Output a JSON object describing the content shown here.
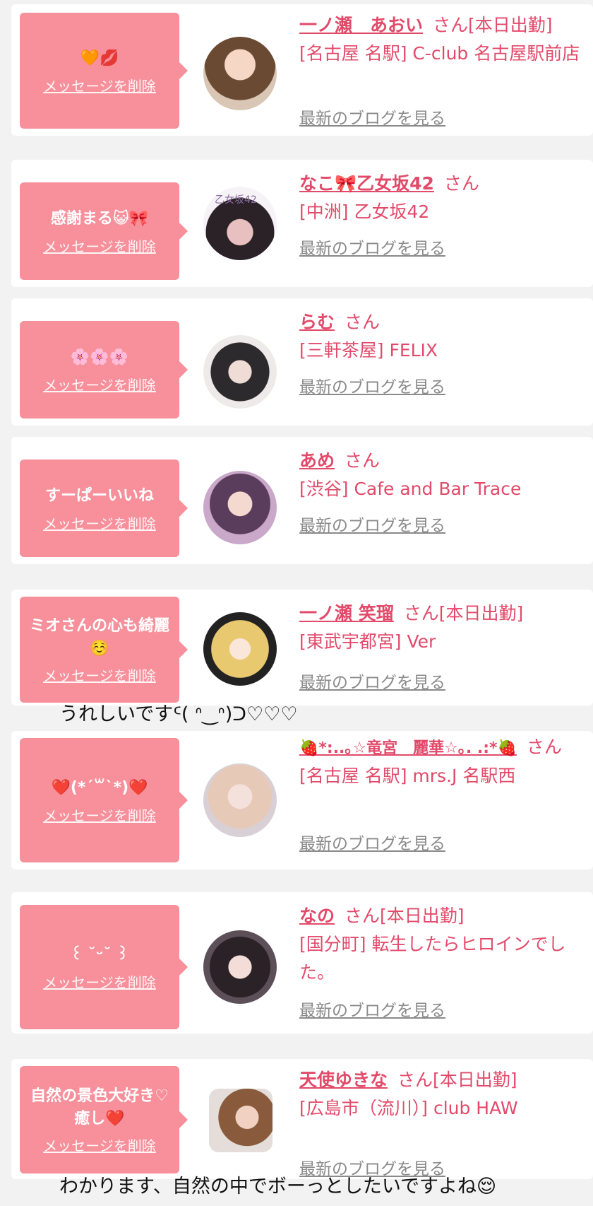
{
  "del_label": "メッセージを削除",
  "blog_label": "最新のブログを見る",
  "entries": [
    {
      "message": "🧡💋",
      "name": "一ノ瀬　あおい",
      "suffix": "さん[本日出勤]",
      "shop": "[名古屋 名駅] C-club 名古屋駅前店"
    },
    {
      "message": "感謝まる😺🎀",
      "name": "なこ🎀乙女坂42",
      "suffix": "さん",
      "shop": "[中洲] 乙女坂42"
    },
    {
      "message": "🌸🌸🌸",
      "name": "らむ",
      "suffix": "さん",
      "shop": "[三軒茶屋] FELIX"
    },
    {
      "message": "すーぱーいいね",
      "name": "あめ",
      "suffix": "さん",
      "shop": "[渋谷] Cafe and Bar Trace"
    },
    {
      "message": "ミオさんの心も綺麗☺️",
      "name": "一ノ瀬 笑瑠",
      "suffix": "さん[本日出勤]",
      "shop": "[東武宇都宮] Ver"
    },
    {
      "message": "❤️(*´꒳`*)❤️",
      "name": "🍓*:..｡☆竜宮　麗華☆｡. .:*🍓",
      "suffix": "さん",
      "shop": "[名古屋 名駅] mrs.J 名駅西"
    },
    {
      "message": "꒰ ˘ᵕ˘ ꒱",
      "name": "なの",
      "suffix": "さん[本日出勤]",
      "shop": "[国分町] 転生したらヒロインでした。"
    },
    {
      "message": "自然の景色大好き♡癒し❤️",
      "name": "天使ゆきな",
      "suffix": "さん[本日出勤]",
      "shop": "[広島市（流川）] club HAW"
    }
  ],
  "overlays": {
    "text1": "うれしいですᑦ( ᐢ‿ᐢ)ᑐ♡♡♡",
    "text2": "わかります、自然の中でボーっとしたいですよね😌"
  },
  "colors": {
    "accent": "#f7909b",
    "link": "#e24a6a"
  },
  "avatar_placeholder_text": "乙女坂42"
}
